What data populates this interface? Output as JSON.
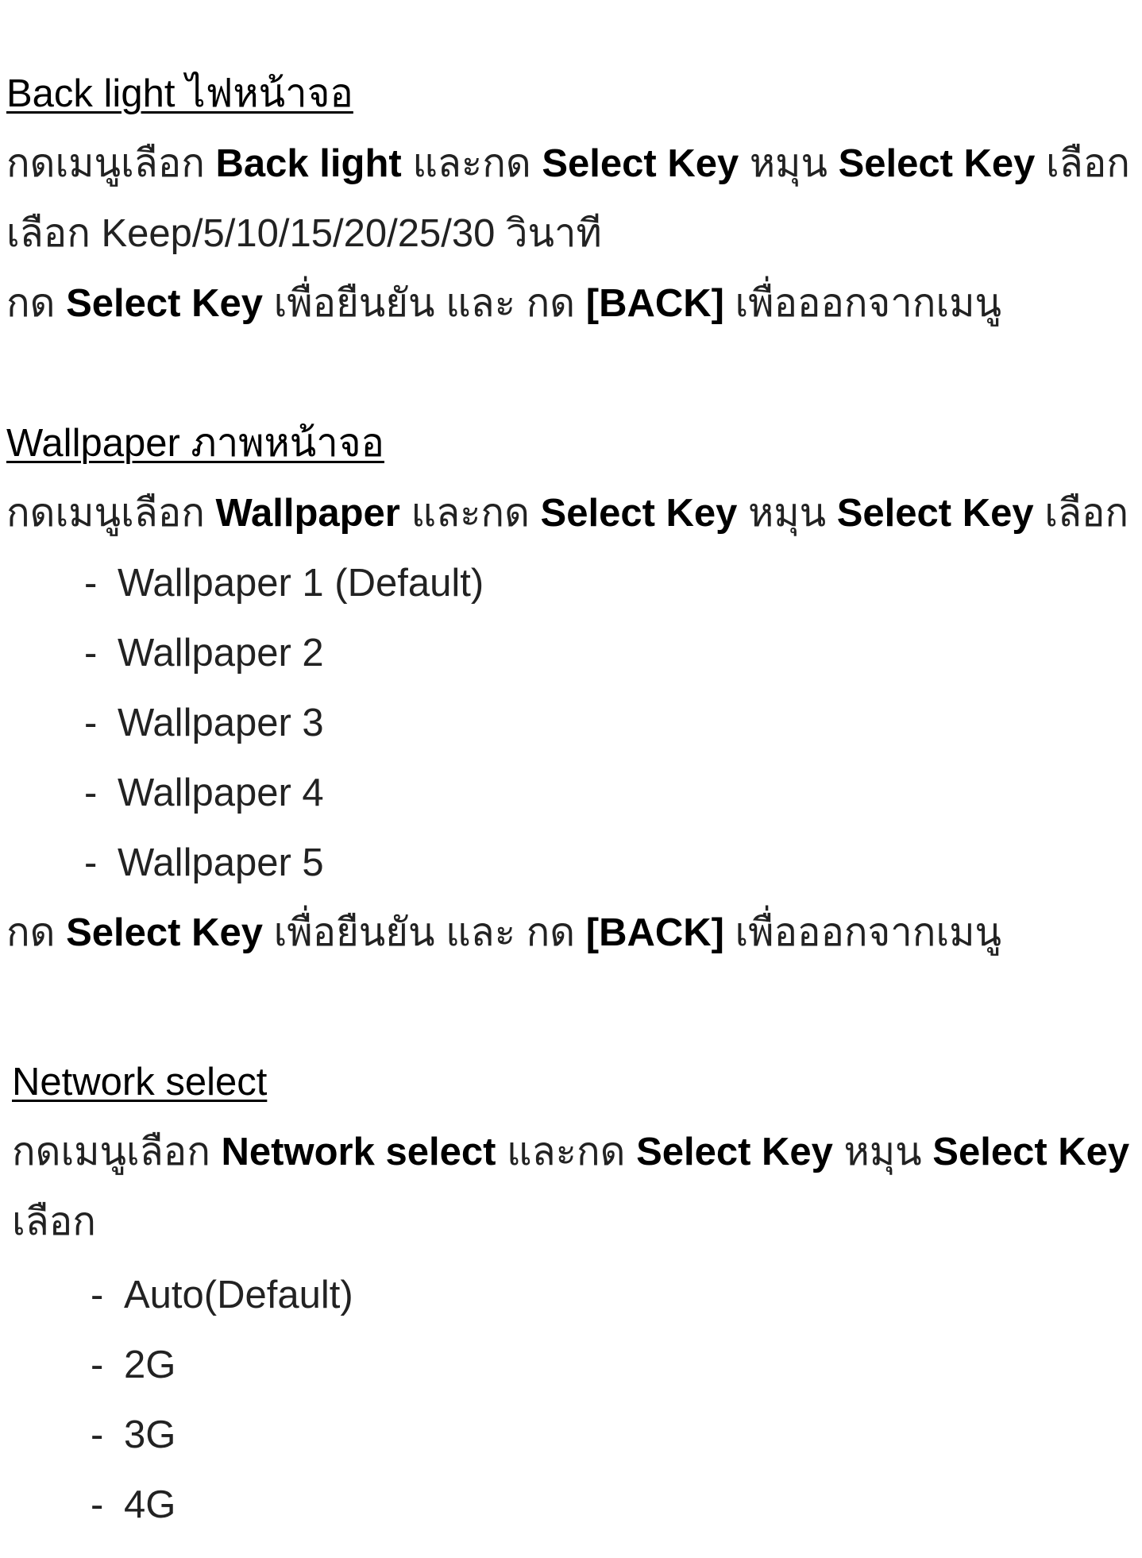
{
  "backlight": {
    "heading": "Back light ไฟหน้าจอ",
    "line1": {
      "t1": "กดเมนูเลือก ",
      "b1": "Back light",
      "t2": " และกด ",
      "b2": "Select Key",
      "t3": " หมุน ",
      "b3": "Select Key",
      "t4": " เลือก"
    },
    "line2": "เลือก Keep/5/10/15/20/25/30 วินาที",
    "line3": {
      "t1": "กด ",
      "b1": "Select Key",
      "t2": " เพื่อยืนยัน และ กด ",
      "b2": "[BACK]",
      "t3": " เพื่อออกจากเมนู"
    }
  },
  "wallpaper": {
    "heading": "Wallpaper ภาพหน้าจอ",
    "line1": {
      "t1": "กดเมนูเลือก ",
      "b1": "Wallpaper",
      "t2": " และกด ",
      "b2": "Select Key",
      "t3": " หมุน ",
      "b3": "Select Key",
      "t4": " เลือก"
    },
    "items": [
      "Wallpaper 1 (Default)",
      "Wallpaper 2",
      "Wallpaper 3",
      "Wallpaper 4",
      "Wallpaper 5"
    ],
    "line_end": {
      "t1": "กด ",
      "b1": "Select Key",
      "t2": " เพื่อยืนยัน และ กด ",
      "b2": "[BACK]",
      "t3": " เพื่อออกจากเมนู"
    }
  },
  "network": {
    "heading": "Network select",
    "line1": {
      "t1": "กดเมนูเลือก ",
      "b1": "Network select",
      "t2": " และกด ",
      "b2": "Select Key",
      "t3": " หมุน ",
      "b3": "Select Key"
    },
    "line2": "เลือก",
    "items": [
      "Auto(Default)",
      "2G",
      "3G",
      "4G"
    ]
  }
}
